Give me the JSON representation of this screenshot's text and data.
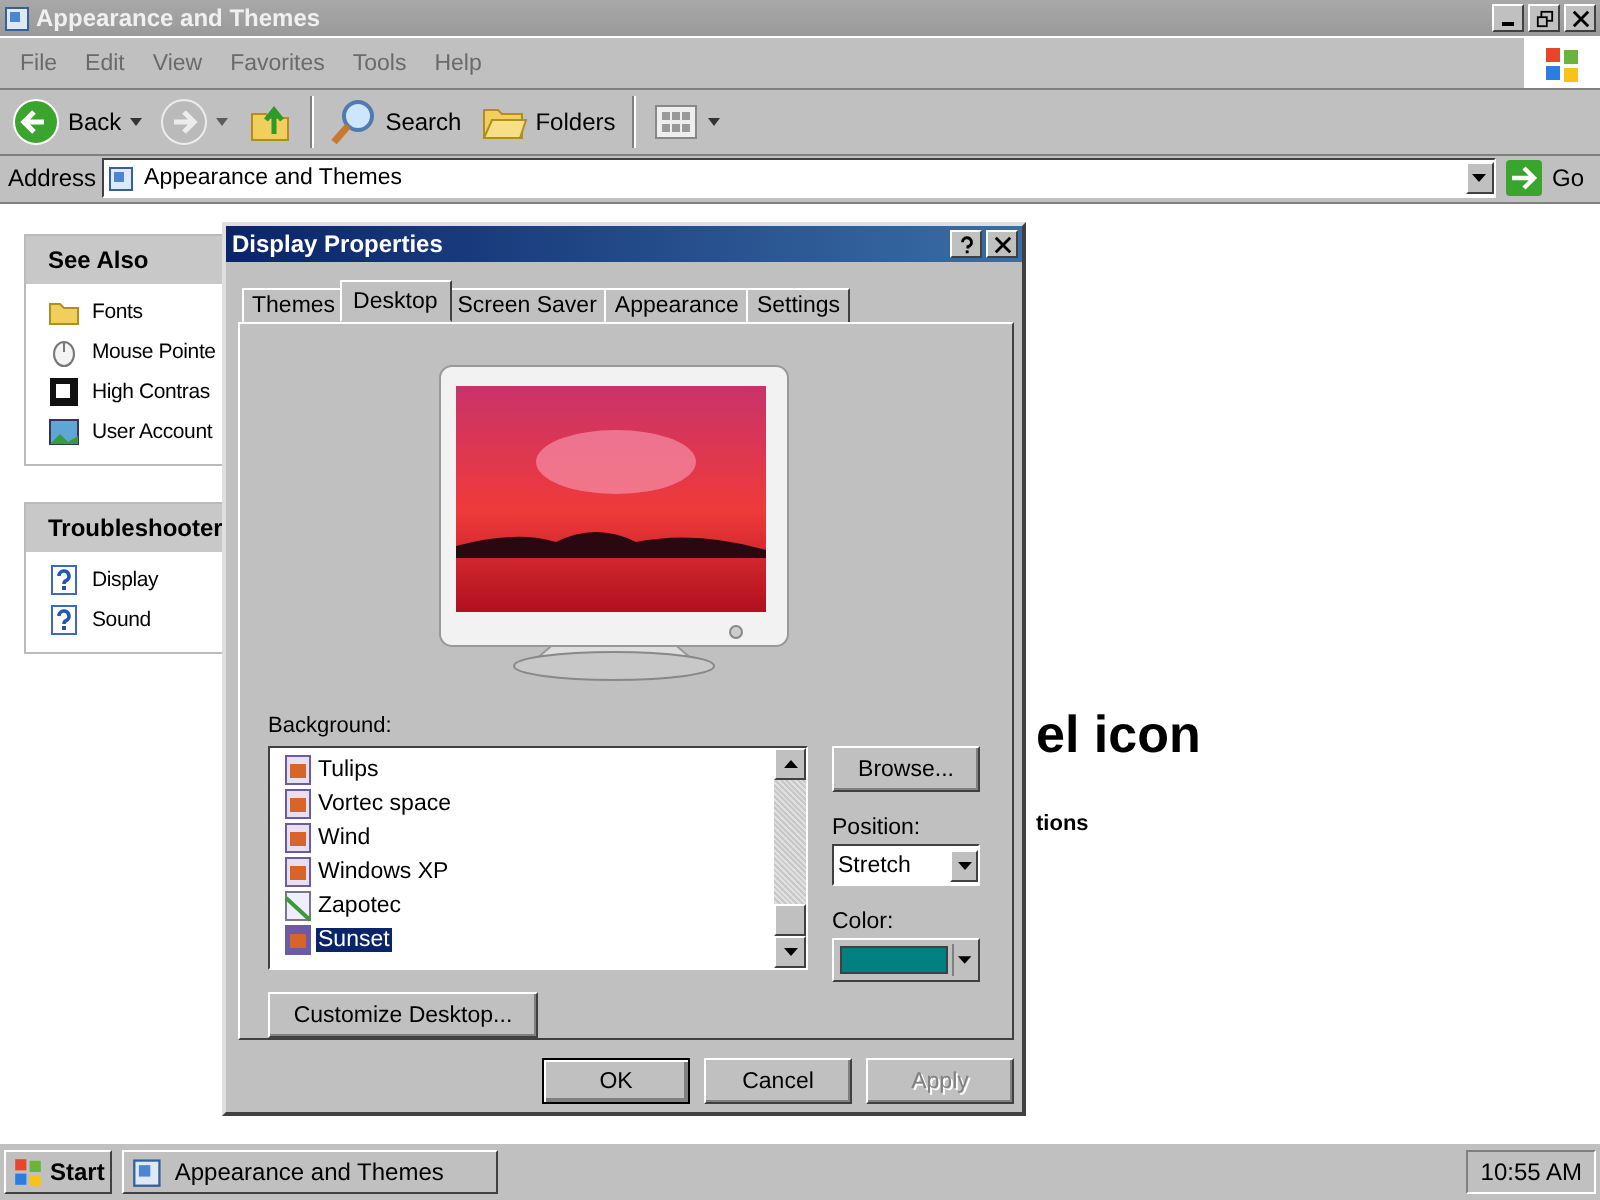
{
  "explorer": {
    "title": "Appearance and Themes",
    "menu": [
      "File",
      "Edit",
      "View",
      "Favorites",
      "Tools",
      "Help"
    ],
    "toolbar": [
      {
        "kind": "back",
        "label": "Back",
        "disabled": false
      },
      {
        "kind": "forward",
        "disabled": true
      },
      {
        "kind": "up",
        "disabled": false
      },
      {
        "kind": "search",
        "label": "Search",
        "disabled": false
      },
      {
        "kind": "folders",
        "label": "Folders",
        "disabled": false
      },
      {
        "kind": "views",
        "disabled": false
      }
    ],
    "address": {
      "label": "Address",
      "value": "Appearance and Themes",
      "go": "Go"
    },
    "panels": [
      {
        "title": "See Also",
        "items": [
          {
            "kind": "fonts",
            "label": "Fonts"
          },
          {
            "kind": "mouse",
            "label": "Mouse Pointe"
          },
          {
            "kind": "contrast",
            "label": "High Contras"
          },
          {
            "kind": "users",
            "label": "User Account"
          }
        ]
      },
      {
        "title": "Troubleshooter",
        "items": [
          {
            "kind": "help",
            "label": "Display"
          },
          {
            "kind": "help",
            "label": "Sound"
          }
        ]
      }
    ],
    "content": {
      "heading": "el icon",
      "subheading": "tions"
    }
  },
  "dialog": {
    "title": "Display Properties",
    "tabs": [
      {
        "label": "Themes",
        "selected": false
      },
      {
        "label": "Desktop",
        "selected": true
      },
      {
        "label": "Screen Saver",
        "selected": false
      },
      {
        "label": "Appearance",
        "selected": false
      },
      {
        "label": "Settings",
        "selected": false
      }
    ],
    "background_label": "Background:",
    "backgrounds": [
      {
        "kind": "image",
        "label": "Tulips",
        "selected": false
      },
      {
        "kind": "image",
        "label": "Vortec space",
        "selected": false
      },
      {
        "kind": "image",
        "label": "Wind",
        "selected": false
      },
      {
        "kind": "image",
        "label": "Windows XP",
        "selected": false
      },
      {
        "kind": "page",
        "label": "Zapotec",
        "selected": false
      },
      {
        "kind": "image",
        "label": "Sunset",
        "selected": true
      }
    ],
    "browse": "Browse...",
    "position": {
      "label": "Position:",
      "value": "Stretch"
    },
    "color": {
      "label": "Color:",
      "color": "#008080"
    },
    "customize": "Customize Desktop...",
    "buttons": [
      {
        "label": "OK",
        "disabled": false
      },
      {
        "label": "Cancel",
        "disabled": false
      },
      {
        "label": "Apply",
        "disabled": true
      }
    ]
  },
  "taskbar": {
    "start": "Start",
    "tasks": [
      {
        "label": "Appearance and Themes"
      }
    ],
    "clock": "10:55 AM"
  }
}
